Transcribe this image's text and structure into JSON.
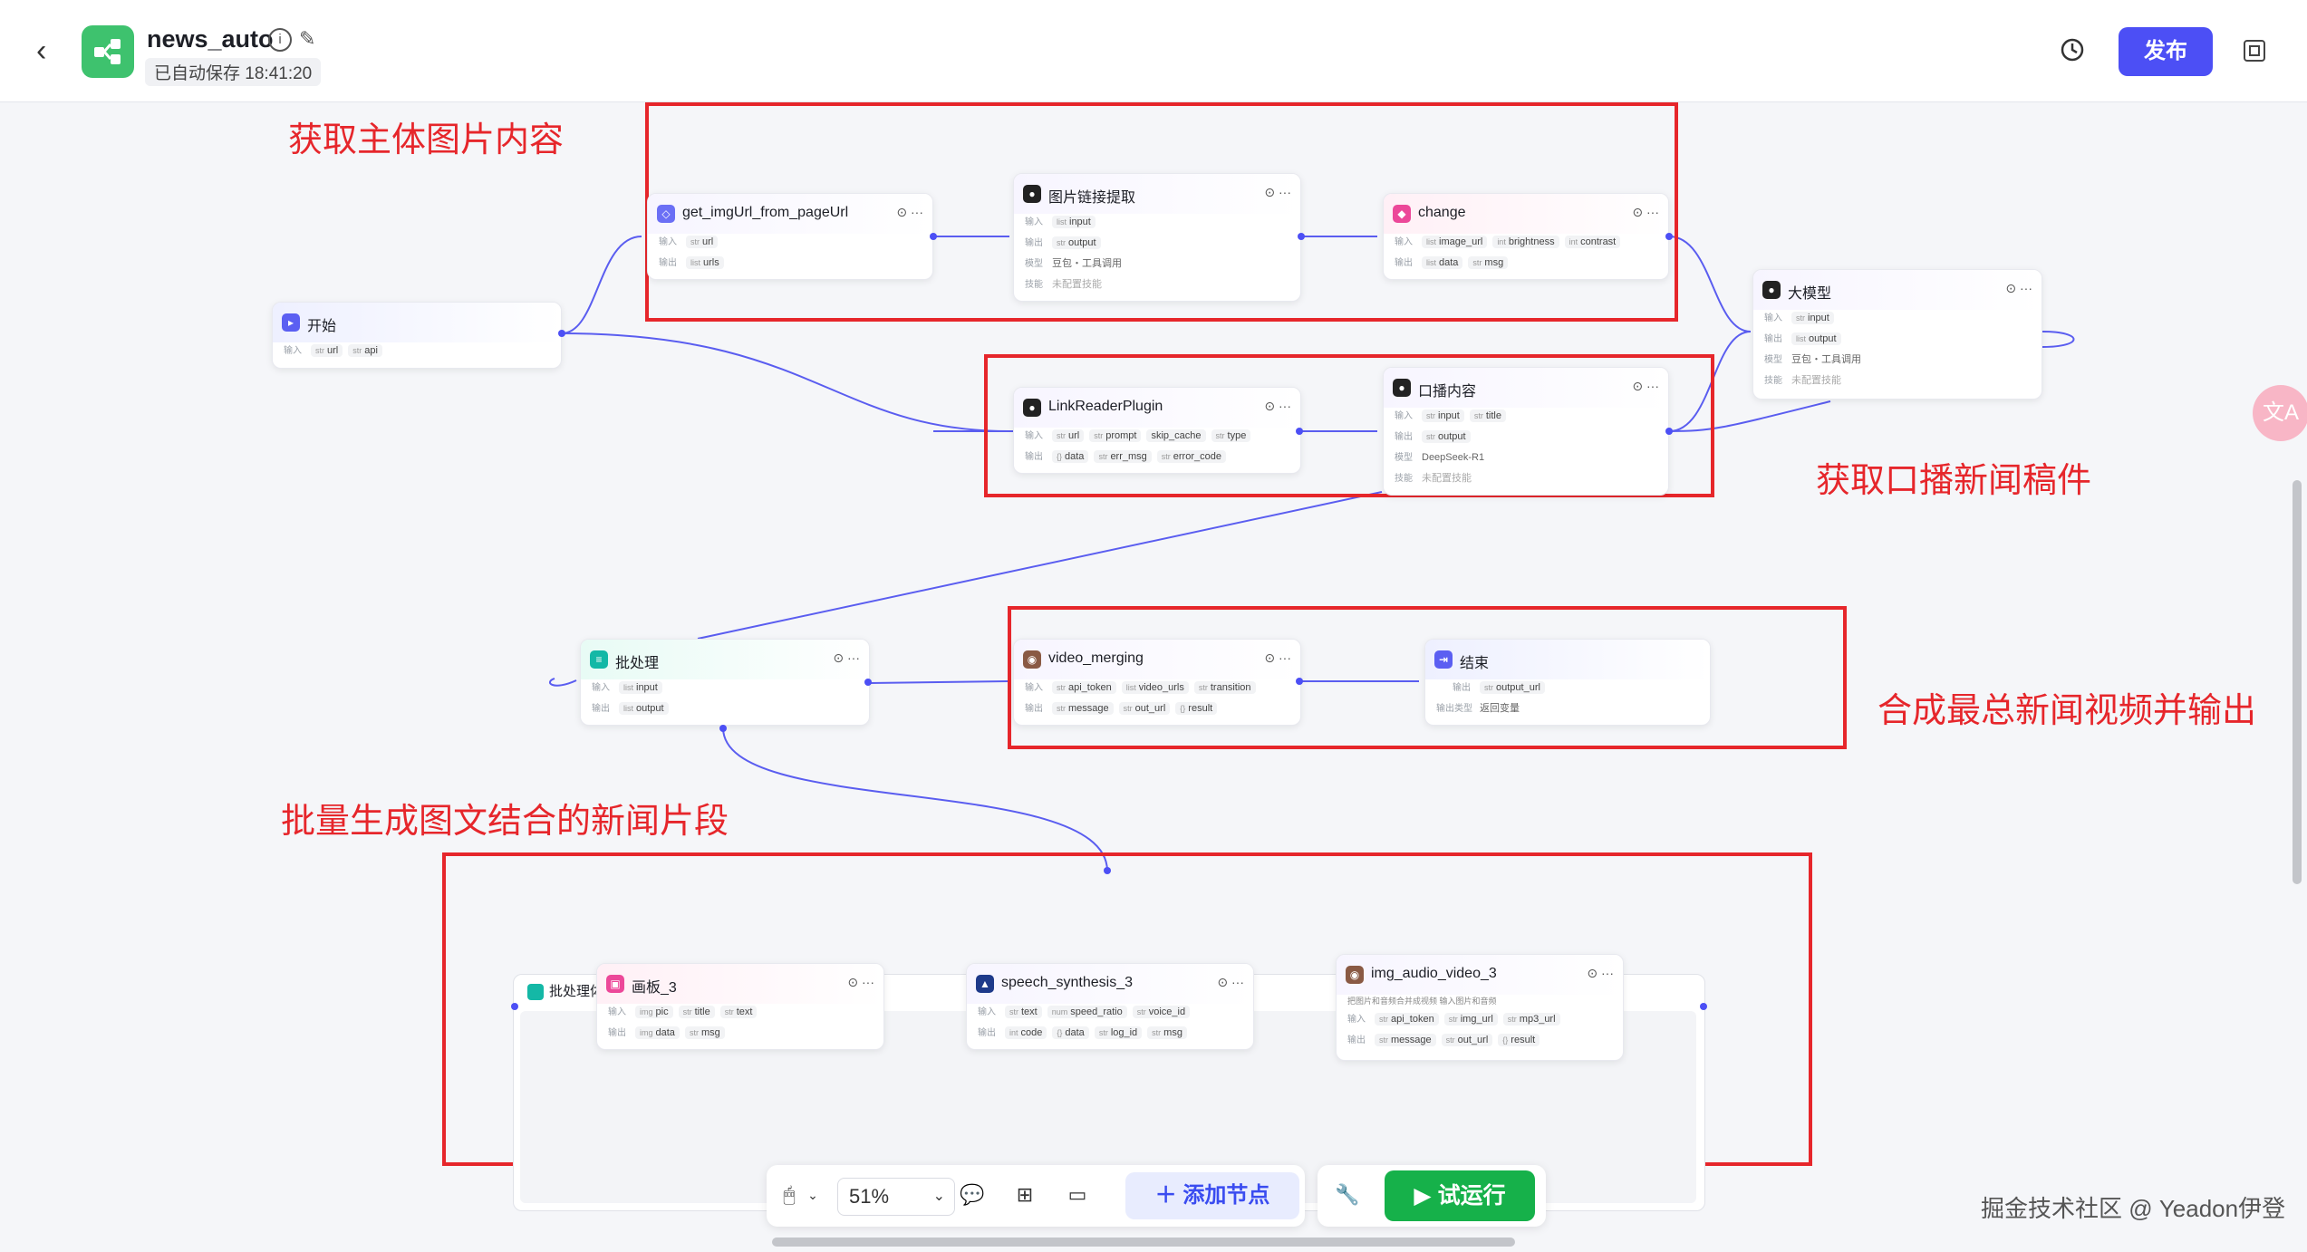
{
  "header": {
    "app_name": "news_auto",
    "autosave": "已自动保存 18:41:20",
    "publish_label": "发布"
  },
  "annotations": {
    "a1": "获取主体图片内容",
    "a2": "获取口播新闻稿件",
    "a3": "合成最总新闻视频并输出",
    "a4": "批量生成图文结合的新闻片段"
  },
  "nodes": {
    "start": {
      "title": "开始",
      "in_label": "输入",
      "chips": [
        "url",
        "api"
      ],
      "types": [
        "str",
        "str"
      ]
    },
    "get_img": {
      "title": "get_imgUrl_from_pageUrl",
      "in_chips": [
        "url"
      ],
      "out_chips": [
        "urls"
      ]
    },
    "img_link": {
      "title": "图片链接提取",
      "in_chips": [
        "input"
      ],
      "out_chips": [
        "output"
      ],
      "model": "豆包・工具调用",
      "skill": "未配置技能"
    },
    "change": {
      "title": "change",
      "in_chips": [
        "image_url",
        "brightness",
        "contrast"
      ],
      "out_chips": [
        "data",
        "msg"
      ]
    },
    "llm": {
      "title": "大模型",
      "in_chips": [
        "input"
      ],
      "out_chips": [
        "output"
      ],
      "model": "豆包・工具调用",
      "skill": "未配置技能"
    },
    "link_reader": {
      "title": "LinkReaderPlugin",
      "in_chips": [
        "url",
        "prompt",
        "skip_cache",
        "type"
      ],
      "out_chips": [
        "data",
        "err_msg",
        "error_code"
      ]
    },
    "broadcast": {
      "title": "口播内容",
      "in_chips": [
        "input",
        "title"
      ],
      "out_chips": [
        "output"
      ],
      "model": "DeepSeek-R1",
      "skill": "未配置技能"
    },
    "batch": {
      "title": "批处理",
      "in_chips": [
        "input"
      ],
      "out_chips": [
        "output"
      ]
    },
    "video_merging": {
      "title": "video_merging",
      "in_chips": [
        "api_token",
        "video_urls",
        "transition"
      ],
      "out_chips": [
        "message",
        "out_url",
        "result"
      ]
    },
    "end": {
      "title": "结束",
      "out_chips": [
        "output_url"
      ],
      "out_type_label": "输出类型",
      "out_type": "返回变量"
    },
    "loop": {
      "title": "批处理体"
    },
    "canvas3": {
      "title": "画板_3",
      "in_chips": [
        "pic",
        "title",
        "text"
      ],
      "out_chips": [
        "data",
        "msg"
      ]
    },
    "speech": {
      "title": "speech_synthesis_3",
      "in_chips": [
        "text",
        "speed_ratio",
        "voice_id"
      ],
      "out_chips": [
        "code",
        "data",
        "log_id",
        "msg"
      ]
    },
    "img_audio": {
      "title": "img_audio_video_3",
      "desc": "把图片和音频合并成视频 输入图片和音频",
      "in_chips": [
        "api_token",
        "img_url",
        "mp3_url"
      ],
      "out_chips": [
        "message",
        "out_url",
        "result"
      ]
    }
  },
  "labels": {
    "input": "输入",
    "output": "输出",
    "model": "模型",
    "skill": "技能"
  },
  "bottombar": {
    "zoom": "51%",
    "add_node": "添加节点",
    "run": "试运行"
  },
  "watermark": "掘金技术社区 @ Yeadon伊登",
  "colors": {
    "accent": "#4c4ff5",
    "run": "#16b14a",
    "annotation": "#e6262b"
  }
}
